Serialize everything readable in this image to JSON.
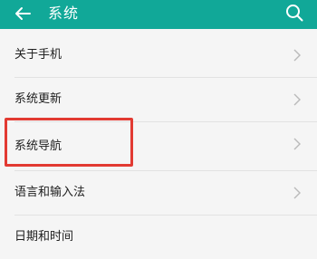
{
  "header": {
    "title": "系统",
    "back_icon": "back-arrow-icon",
    "search_icon": "search-icon",
    "background": "#11a898"
  },
  "settings": {
    "items": [
      {
        "label": "关于手机"
      },
      {
        "label": "系统更新"
      },
      {
        "label": "系统导航"
      },
      {
        "label": "语言和输入法"
      },
      {
        "label": "日期和时间"
      }
    ]
  },
  "highlight_color": "#e23a32"
}
